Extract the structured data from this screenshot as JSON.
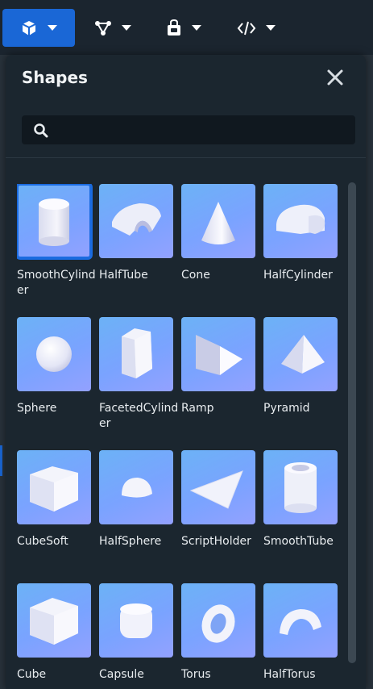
{
  "toolbar": {
    "buttons": [
      {
        "name": "parts",
        "icon": "cube-icon",
        "active": true
      },
      {
        "name": "connections",
        "icon": "nodes-icon",
        "active": false
      },
      {
        "name": "inventory",
        "icon": "lock-bag-icon",
        "active": false
      },
      {
        "name": "scripts",
        "icon": "code-icon",
        "active": false
      }
    ]
  },
  "panel": {
    "title": "Shapes",
    "search_value": "",
    "search_placeholder": ""
  },
  "shapes": [
    {
      "label": "SmoothCylinder",
      "shape": "cylinder",
      "selected": true
    },
    {
      "label": "HalfTube",
      "shape": "halftube"
    },
    {
      "label": "Cone",
      "shape": "cone"
    },
    {
      "label": "HalfCylinder",
      "shape": "halfcylinder"
    },
    {
      "label": "Sphere",
      "shape": "sphere"
    },
    {
      "label": "FacetedCylinder",
      "shape": "faceted"
    },
    {
      "label": "Ramp",
      "shape": "ramp"
    },
    {
      "label": "Pyramid",
      "shape": "pyramid"
    },
    {
      "label": "CubeSoft",
      "shape": "cubesoft"
    },
    {
      "label": "HalfSphere",
      "shape": "halfsphere"
    },
    {
      "label": "ScriptHolder",
      "shape": "scriptholder"
    },
    {
      "label": "SmoothTube",
      "shape": "smoothtube"
    },
    {
      "label": "Cube",
      "shape": "cube"
    },
    {
      "label": "Capsule",
      "shape": "capsule"
    },
    {
      "label": "Torus",
      "shape": "torus"
    },
    {
      "label": "HalfTorus",
      "shape": "halftorus"
    }
  ],
  "colors": {
    "accent": "#1a67d6",
    "panel_bg": "#1b262f",
    "tile_gradient_start": "#6cb2f6",
    "tile_gradient_end": "#93a1ff"
  }
}
